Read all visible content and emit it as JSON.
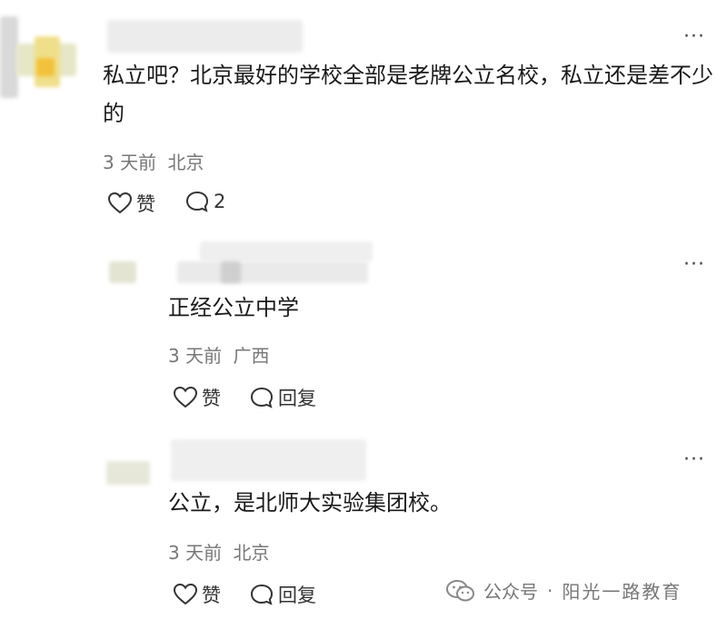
{
  "comments": [
    {
      "text": "私立吧？北京最好的学校全部是老牌公立名校，私立还是差不少的",
      "time": "3 天前",
      "location": "北京",
      "like_label": "赞",
      "reply_label": "2"
    },
    {
      "text": "正经公立中学",
      "time": "3 天前",
      "location": "广西",
      "like_label": "赞",
      "reply_label": "回复"
    },
    {
      "text": "公立，是北师大实验集团校。",
      "time": "3 天前",
      "location": "北京",
      "like_label": "赞",
      "reply_label": "回复"
    }
  ],
  "more_label": "···",
  "watermark": {
    "prefix": "公众号",
    "separator": "·",
    "account": "阳光一路教育"
  },
  "colors": {
    "text": "#1a1a1a",
    "meta": "#777777",
    "icon": "#333333"
  }
}
